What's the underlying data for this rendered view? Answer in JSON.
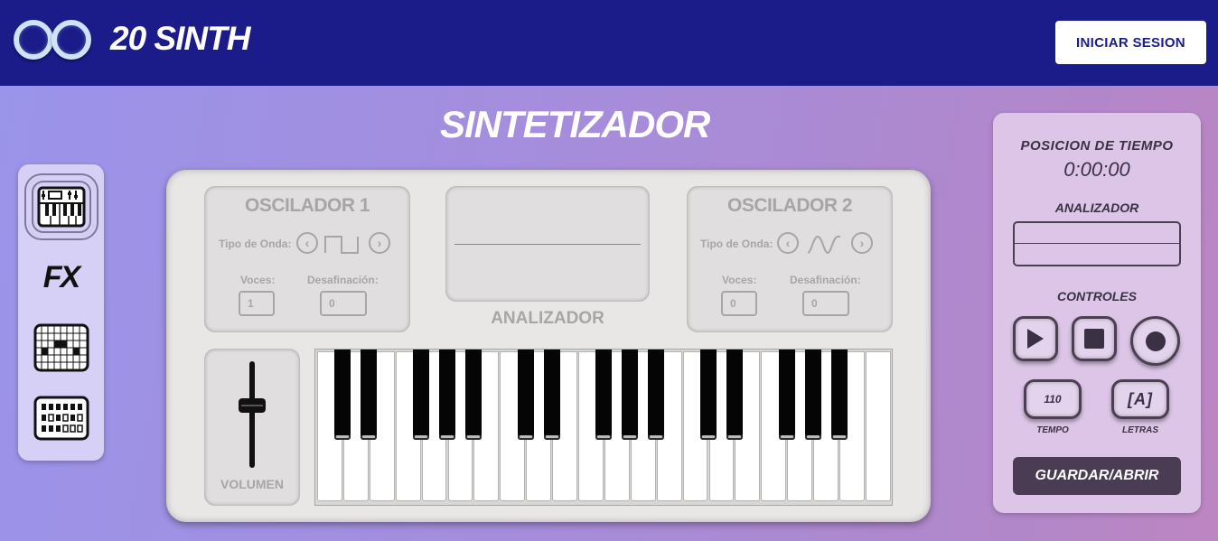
{
  "header": {
    "brand": "20 SINTH",
    "login_label": "INICIAR SESION"
  },
  "page_title": "SINTETIZADOR",
  "nav": {
    "items": [
      {
        "name": "synth",
        "icon": "synth-keyboard-icon",
        "active": true
      },
      {
        "name": "fx",
        "label": "FX",
        "icon": "fx-icon"
      },
      {
        "name": "sequencer",
        "icon": "sequencer-grid-icon"
      },
      {
        "name": "drum-machine",
        "icon": "drum-machine-icon"
      }
    ]
  },
  "oscillator1": {
    "title": "OSCILADOR 1",
    "wave_label": "Tipo de Onda:",
    "wave": "square-wave-icon",
    "voices_label": "Voces:",
    "voices": "1",
    "detune_label": "Desafinación:",
    "detune": "0"
  },
  "oscillator2": {
    "title": "OSCILADOR 2",
    "wave_label": "Tipo de Onda:",
    "wave": "sine-wave-icon",
    "voices_label": "Voces:",
    "voices": "0",
    "detune_label": "Desafinación:",
    "detune": "0"
  },
  "analyzer": {
    "label": "ANALIZADOR"
  },
  "volume": {
    "label": "VOLUMEN",
    "level": 0.6
  },
  "keyboard": {
    "white_keys": 22,
    "black_keys": 15
  },
  "side": {
    "time_label": "POSICION DE TIEMPO",
    "time_value": "0:00:00",
    "analyzer_label": "ANALIZADOR",
    "controls_label": "CONTROLES",
    "tempo_value": "110",
    "tempo_label": "TEMPO",
    "letters_value": "[A]",
    "letters_label": "LETRAS",
    "save_label": "GUARDAR/ABRIR"
  },
  "colors": {
    "header": "#1b1c8a",
    "panel": "#e9e6e6",
    "side_panel": "#dcc5e7",
    "save_button": "#4a3c52"
  }
}
